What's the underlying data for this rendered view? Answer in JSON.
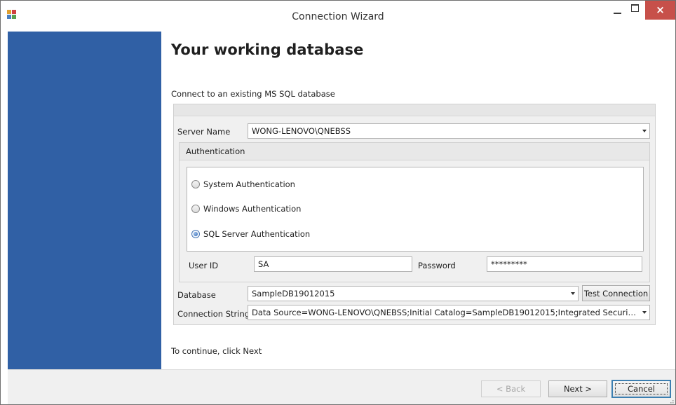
{
  "window": {
    "title": "Connection Wizard",
    "icons": {
      "app": "database-app-icon",
      "minimize": "minimize-icon",
      "maximize": "maximize-icon",
      "close": "close-icon"
    },
    "close_glyph": "×"
  },
  "page": {
    "heading": "Your working database",
    "subtitle": "Connect to an existing MS SQL database",
    "continue_hint": "To continue, click Next"
  },
  "form": {
    "server_name": {
      "label": "Server Name",
      "value": "WONG-LENOVO\\QNEBSS"
    },
    "authentication": {
      "caption": "Authentication",
      "options": [
        {
          "label": "System Authentication",
          "selected": false
        },
        {
          "label": "Windows Authentication",
          "selected": false
        },
        {
          "label": "SQL Server Authentication",
          "selected": true
        }
      ],
      "user_id": {
        "label": "User ID",
        "value": "SA"
      },
      "password": {
        "label": "Password",
        "value": "*********"
      }
    },
    "database": {
      "label": "Database",
      "value": "SampleDB19012015"
    },
    "test_connection_label": "Test Connection",
    "connection_string": {
      "label": "Connection String",
      "value": "Data Source=WONG-LENOVO\\QNEBSS;Initial Catalog=SampleDB19012015;Integrated Security=F..."
    }
  },
  "buttons": {
    "back": "< Back",
    "next": "Next >",
    "cancel": "Cancel"
  },
  "colors": {
    "side_panel": "#3060a5",
    "close_button": "#c7504a",
    "default_button_border": "#3c7fb1"
  }
}
